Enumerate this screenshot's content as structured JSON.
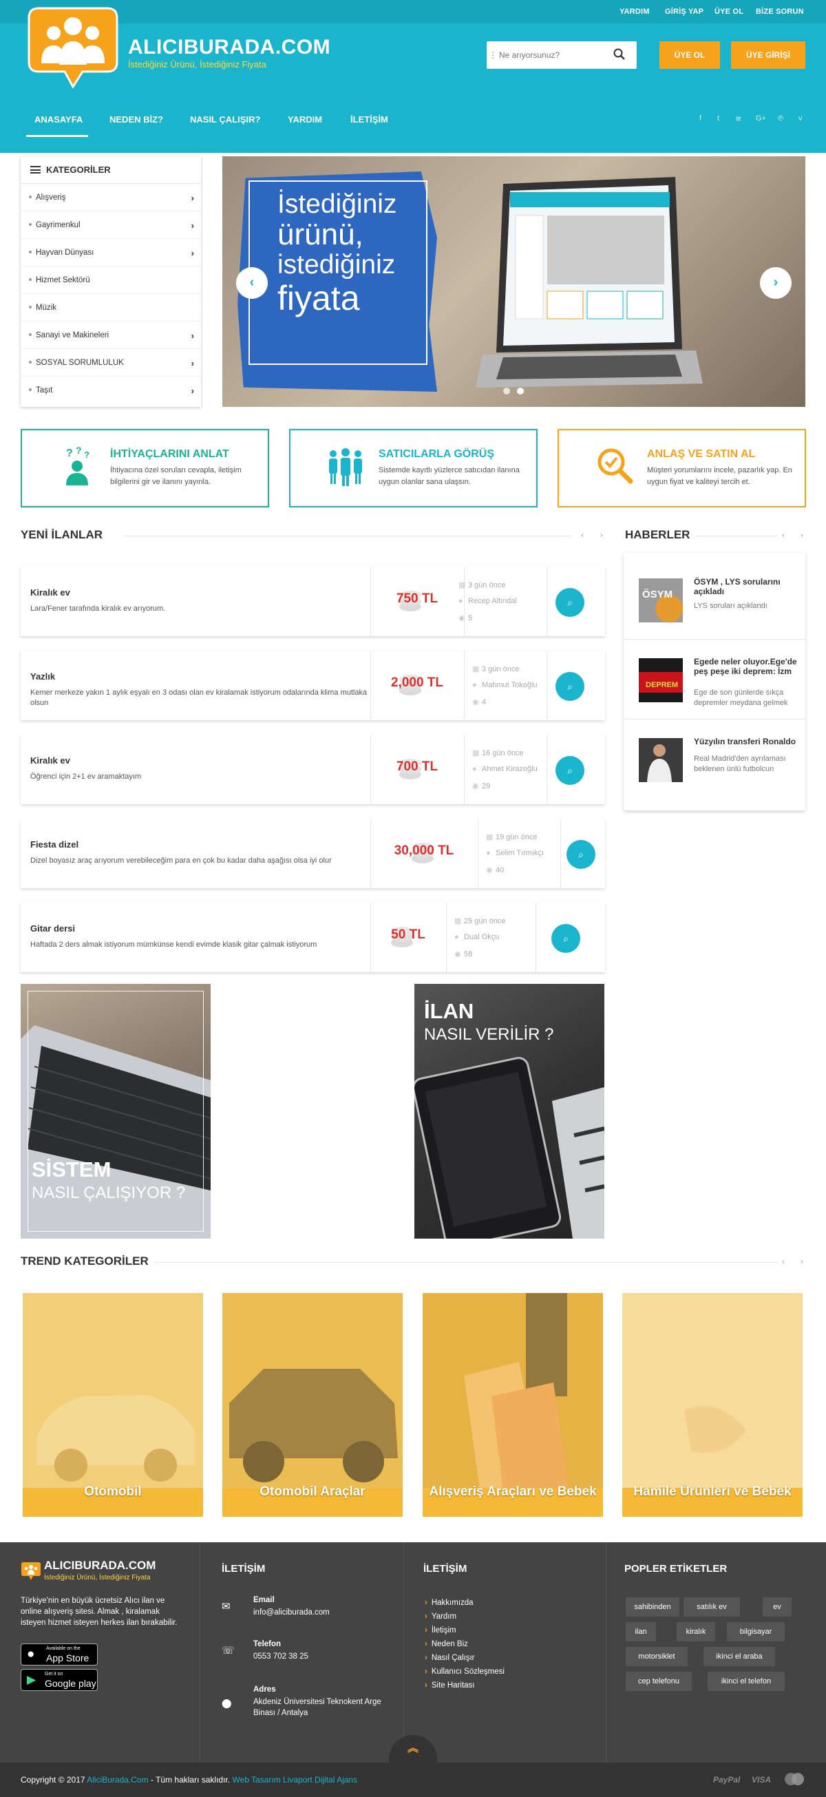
{
  "topbar": {
    "links": [
      "YARDIM",
      "GİRİŞ YAP",
      "ÜYE OL",
      "BİZE SORUN"
    ]
  },
  "brand": {
    "name": "ALICIBURADA.COM",
    "slogan": "İstediğiniz Ürünü, İstediğiniz Fiyata"
  },
  "search": {
    "placeholder": "Ne arıyorsunuz?"
  },
  "header_buttons": {
    "register": "ÜYE OL",
    "login": "ÜYE GİRİŞİ"
  },
  "nav": [
    "ANASAYFA",
    "NEDEN BİZ?",
    "NASIL ÇALIŞIR?",
    "YARDIM",
    "İLETİŞİM"
  ],
  "social_icons": [
    "facebook-icon",
    "twitter-icon",
    "rss-icon",
    "google-plus-icon",
    "pinterest-icon",
    "vimeo-icon"
  ],
  "social_glyphs": [
    "f",
    "t",
    "≋",
    "G+",
    "℗",
    "v"
  ],
  "categories": {
    "title": "KATEGORİLER",
    "items": [
      {
        "label": "Alışveriş",
        "has_sub": true
      },
      {
        "label": "Gayrimenkul",
        "has_sub": true
      },
      {
        "label": "Hayvan Dünyası",
        "has_sub": true
      },
      {
        "label": "Hizmet Sektörü",
        "has_sub": false
      },
      {
        "label": "Müzik",
        "has_sub": false
      },
      {
        "label": "Sanayi ve Makineleri",
        "has_sub": true
      },
      {
        "label": "SOSYAL SORUMLULUK",
        "has_sub": true
      },
      {
        "label": "Taşıt",
        "has_sub": true
      }
    ]
  },
  "slider": {
    "lines": [
      "İstediğiniz",
      "ürünü,",
      "istediğiniz",
      "fiyata"
    ],
    "prev": "‹",
    "next": "›"
  },
  "features": [
    {
      "title": "İHTİYAÇLARINI ANLAT",
      "desc": "İhtiyacına özel soruları cevapla, iletişim bilgilerini gir ve ilanını yayınla.",
      "color": "#1ab394",
      "icon": "question-person-icon"
    },
    {
      "title": "SATICILARLA GÖRÜŞ",
      "desc": "Sistemde kayıtlı yüzlerce satıcıdan ilanına uygun olanlar sana ulaşsın.",
      "color": "#1ab5cc",
      "icon": "people-group-icon"
    },
    {
      "title": "ANLAŞ VE SATIN AL",
      "desc": "Müşteri yorumlarını incele, pazarlık yap. En uygun fiyat ve kaliteyi tercih et.",
      "color": "#f7a21b",
      "icon": "magnifier-check-icon"
    }
  ],
  "listings_section": {
    "title": "YENİ İLANLAR"
  },
  "listings": [
    {
      "title": "Kiralık ev",
      "desc": "Lara/Fener tarafında kiralık ev arıyorum.",
      "price": "750 TL",
      "when": "3 gün önce",
      "user": "Recep Altındal",
      "views": "5"
    },
    {
      "title": "Yazlık",
      "desc": "Kemer merkeze yakın 1 aylık eşyalı en 3 odası olan ev kiralamak istiyorum odalarında klima mutlaka olsun",
      "price": "2,000 TL",
      "when": "3 gün önce",
      "user": "Mahmut Tokoğlu",
      "views": "4"
    },
    {
      "title": "Kiralık ev",
      "desc": "Öğrenci için 2+1 ev aramaktayım",
      "price": "700 TL",
      "when": "16 gün önce",
      "user": "Ahmet Kirazoğlu",
      "views": "29"
    },
    {
      "title": "Fiesta dizel",
      "desc": "Dizel boyasız araç arıyorum verebileceğim para en çok bu kadar daha aşağısı olsa iyi olur",
      "price": "30,000 TL",
      "when": "19 gün önce",
      "user": "Selim Tırmıkçı",
      "views": "40"
    },
    {
      "title": "Gitar dersi",
      "desc": "Haftada 2 ders almak istiyorum mümkünse kendi evimde klasik gitar çalmak istiyorum",
      "price": "50 TL",
      "when": "25 gün önce",
      "user": "Dual Okçu",
      "views": "58"
    }
  ],
  "news_section": {
    "title": "HABERLER"
  },
  "news": [
    {
      "title": "ÖSYM , LYS sorularını açıkladı",
      "desc": "LYS soruları açıklandı",
      "thumb_label": "ÖSYM"
    },
    {
      "title": "Egede neler oluyor.Ege'de peş peşe iki deprem: İzm",
      "desc": "Ege de son günlerde sıkça depremler meydana gelmek",
      "thumb_label": "DEPREM"
    },
    {
      "title": "Yüzyılın transferi Ronaldo",
      "desc": "Real Madrid'den ayrılaması beklenen ünlü futbolcun",
      "thumb_label": ""
    }
  ],
  "promos": [
    {
      "line1": "SİSTEM",
      "line2": "NASIL ÇALIŞIYOR ?"
    },
    {
      "line1": "İLAN",
      "line2": "NASIL VERİLİR ?"
    }
  ],
  "trend_section": {
    "title": "TREND KATEGORİLER"
  },
  "trends": [
    "Otomobil",
    "Otomobil Araçlar",
    "Alışveriş Araçları ve Bebek",
    "Hamile Ürünleri ve Bebek"
  ],
  "footer": {
    "brand": "ALICIBURADA.COM",
    "slogan": "İstediğiniz Ürünü, İstediğiniz Fiyata",
    "about": "Türkiye'nin en büyük ücretsiz Alıcı ilan ve online alışveriş sitesi. Almak , kiralamak isteyen hizmet isteyen herkes ilan bırakabilir.",
    "appstore_small": "Available on the",
    "appstore": "App Store",
    "gplay_small": "Get it on",
    "gplay": "Google play",
    "contact_title": "İLETİŞİM",
    "email_label": "Email",
    "email": "info@aliciburada.com",
    "phone_label": "Telefon",
    "phone": "0553 702 38 25",
    "address_label": "Adres",
    "address": "Akdeniz Üniversitesi Teknokent Arge Binası / Antalya",
    "links_title": "İLETİŞİM",
    "links": [
      "Hakkımızda",
      "Yardım",
      "İletişim",
      "Neden Biz",
      "Nasıl Çalışır",
      "Kullanıcı Sözleşmesi",
      "Site Haritası"
    ],
    "tags_title": "POPLER ETİKETLER",
    "tags": [
      "sahibinden",
      "satılık ev",
      "ev",
      "ilan",
      "kiralık",
      "bilgisayar",
      "motorsiklet",
      "ikinci el araba",
      "cep telefonu",
      "ikinci el telefon"
    ],
    "copyright_pre": "Copyright © 2017",
    "copyright_site": "AliciBurada.Com",
    "copyright_mid": "- Tüm hakları saklıdır.",
    "copyright_link": "Web Tasarım Livaport Dijital Ajans",
    "payments": [
      "PayPal",
      "VISA"
    ]
  },
  "colors": {
    "primary": "#1ab5cc",
    "accent": "#f7a21b",
    "price": "#d9322d",
    "green": "#1ab394"
  }
}
